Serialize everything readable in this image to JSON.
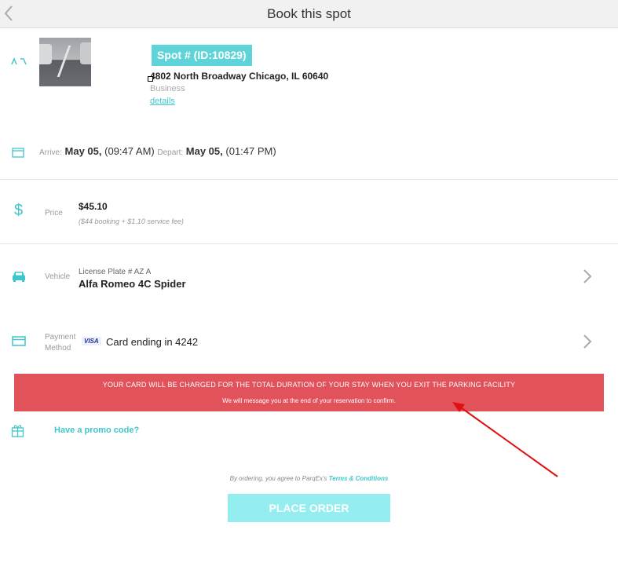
{
  "header": {
    "title": "Book this spot"
  },
  "spot": {
    "badge": "Spot # (ID:10829)",
    "address": "4802 North Broadway Chicago, IL 60640",
    "type": "Business",
    "details_link": "details"
  },
  "schedule": {
    "arrive_label": "Arrive:",
    "arrive_date": "May 05,",
    "arrive_time": "(09:47 AM)",
    "depart_label": "Depart:",
    "depart_date": "May 05,",
    "depart_time": "(01:47 PM)"
  },
  "price": {
    "label": "Price",
    "value": "$45.10",
    "note": "($44 booking + $1.10 service fee)"
  },
  "vehicle": {
    "label": "Vehicle",
    "plate": "License Plate # AZ A",
    "name": "Alfa Romeo 4C Spider"
  },
  "payment": {
    "label_line1": "Payment",
    "label_line2": "Method",
    "card_brand": "VISA",
    "card_text": "Card ending in 4242"
  },
  "notice": {
    "line1": "YOUR CARD WILL BE CHARGED FOR THE TOTAL DURATION OF YOUR STAY WHEN YOU EXIT THE PARKING FACILITY",
    "line2": "We will message you at the end of your reservation to confirm."
  },
  "promo": {
    "label": "Have a promo code?"
  },
  "legal": {
    "prefix": "By ordering, you agree to ParqEx's",
    "terms_link": "Terms & Conditions"
  },
  "actions": {
    "place_order": "PLACE ORDER"
  },
  "colors": {
    "accent": "#3fc6cc",
    "banner": "#e2525b",
    "button": "#94eef0",
    "annotation_arrow": "#e01010"
  }
}
